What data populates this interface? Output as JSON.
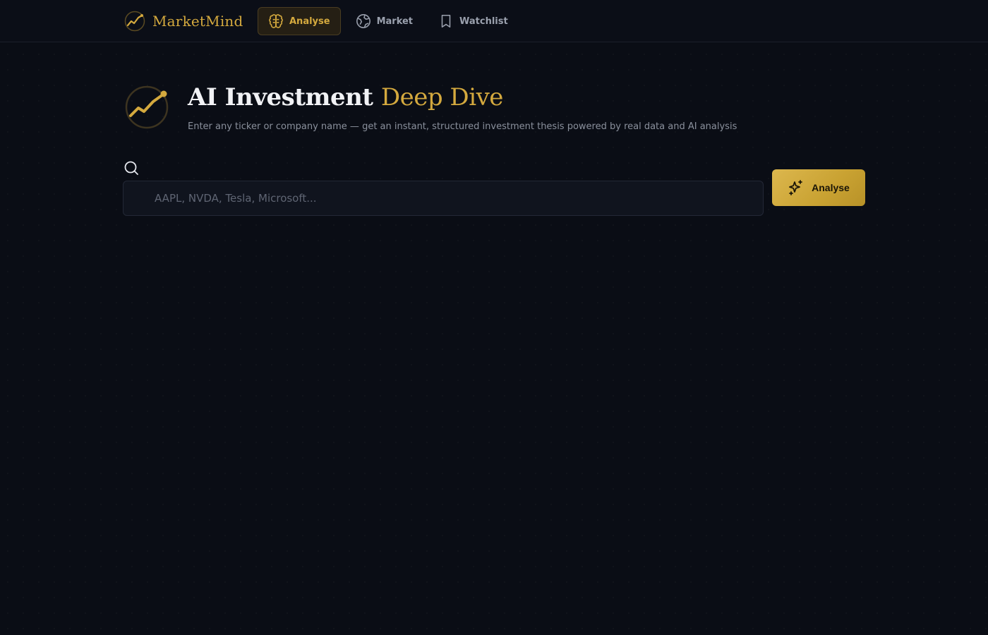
{
  "brand": {
    "name": "MarketMind",
    "accent_color": "#d4a93e"
  },
  "nav": {
    "items": [
      {
        "label": "Analyse",
        "icon": "brain-icon",
        "active": true
      },
      {
        "label": "Market",
        "icon": "globe-icon",
        "active": false
      },
      {
        "label": "Watchlist",
        "icon": "bookmark-icon",
        "active": false
      }
    ]
  },
  "hero": {
    "title_main": "AI Investment",
    "title_accent": "Deep Dive",
    "subtitle": "Enter any ticker or company name — get an instant, structured investment thesis powered by real data and AI analysis"
  },
  "search": {
    "icon": "search-icon",
    "placeholder": "AAPL, NVDA, Tesla, Microsoft...",
    "value": ""
  },
  "analyse_button": {
    "label": "Analyse",
    "icon": "sparkles-icon"
  },
  "colors": {
    "background": "#0a0d15",
    "gold": "#d4a93e",
    "muted_text": "#8a909c"
  }
}
